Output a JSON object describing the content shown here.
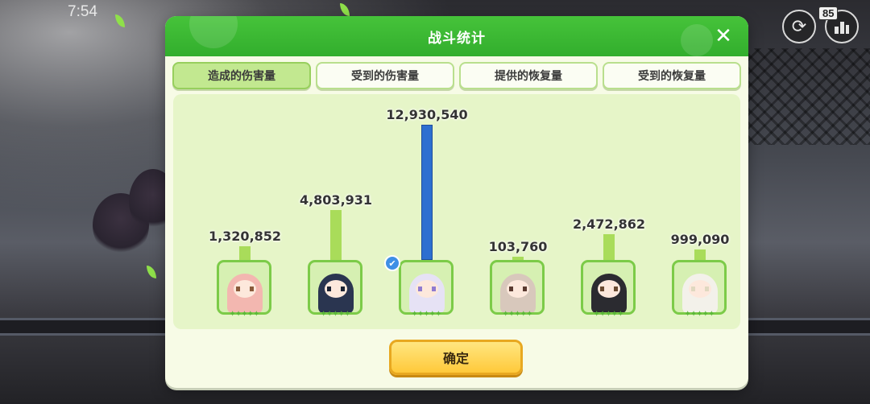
{
  "status": {
    "time": "7:54",
    "speed": "85"
  },
  "modal": {
    "title": "战斗统计",
    "confirm": "确定"
  },
  "tabs": [
    {
      "label": "造成的伤害量",
      "active": true
    },
    {
      "label": "受到的伤害量",
      "active": false
    },
    {
      "label": "提供的恢复量",
      "active": false
    },
    {
      "label": "受到的恢复量",
      "active": false
    }
  ],
  "chart_data": {
    "type": "bar",
    "categories": [
      "character-1",
      "character-2",
      "character-3",
      "character-4",
      "character-5",
      "character-6"
    ],
    "values": [
      1320852,
      4803931,
      12930540,
      103760,
      2472862,
      999090
    ],
    "labels": [
      "1,320,852",
      "4,803,931",
      "12,930,540",
      "103,760",
      "2,472,862",
      "999,090"
    ],
    "highlight_index": 2,
    "colors": {
      "normal": "#a9dc5a",
      "highlight": "#2d6fd0"
    }
  },
  "characters": [
    {
      "hair": "#f3b7b0",
      "accent": "#8a5a3a"
    },
    {
      "hair": "#2a3550",
      "accent": "#1b2233"
    },
    {
      "hair": "#e6e2f5",
      "accent": "#8f7bd0"
    },
    {
      "hair": "#d8c8bc",
      "accent": "#5a3a30"
    },
    {
      "hair": "#2b2b30",
      "accent": "#6a4a30"
    },
    {
      "hair": "#f3f1ea",
      "accent": "#e0d8c0"
    }
  ],
  "icons": {
    "refresh": "refresh-icon",
    "stats": "stats-icon",
    "close": "close-icon",
    "mvp": "thumbs-up-icon"
  }
}
